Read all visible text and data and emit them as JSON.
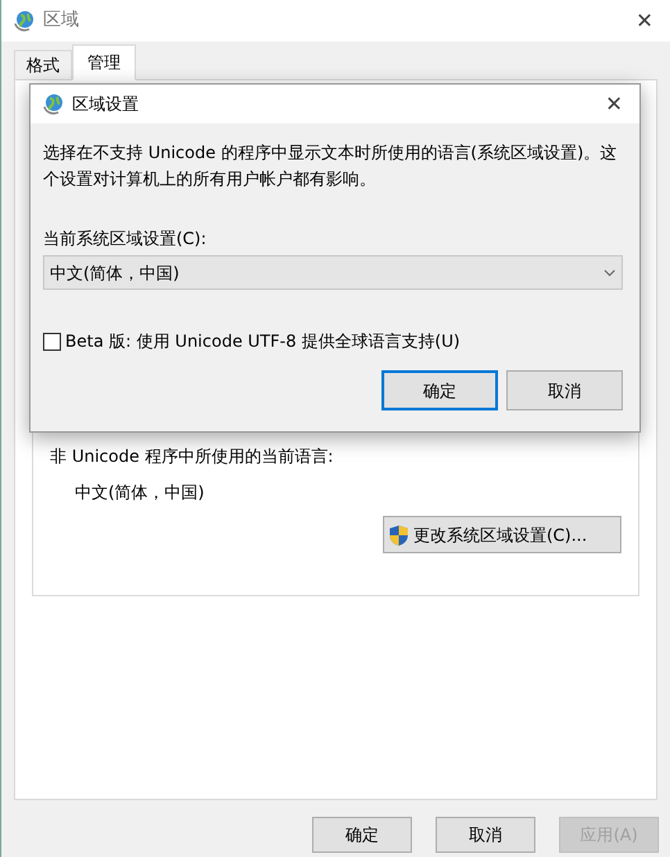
{
  "window": {
    "title": "区域",
    "close": "✕"
  },
  "tabs": [
    {
      "label": "格式",
      "selected": false
    },
    {
      "label": "管理",
      "selected": true
    }
  ],
  "panel": {
    "label": "非 Unicode 程序中所使用的当前语言:",
    "value": "中文(简体，中国)",
    "button": "更改系统区域设置(C)..."
  },
  "buttons": [
    {
      "label": "确定",
      "disabled": false
    },
    {
      "label": "取消",
      "disabled": false
    },
    {
      "label": "应用(A)",
      "disabled": true
    }
  ],
  "dialog": {
    "title": "区域设置",
    "close": "✕",
    "description": "选择在不支持 Unicode 的程序中显示文本时所使用的语言(系统区域设置)。这个设置对计算机上的所有用户帐户都有影响。",
    "locale_label": "当前系统区域设置(C):",
    "locale_value": "中文(简体，中国)",
    "beta": {
      "label": "Beta 版: 使用 Unicode UTF-8 提供全球语言支持(U)",
      "checked": false
    },
    "buttons": [
      {
        "label": "确定",
        "default": true
      },
      {
        "label": "取消",
        "default": false
      }
    ]
  }
}
